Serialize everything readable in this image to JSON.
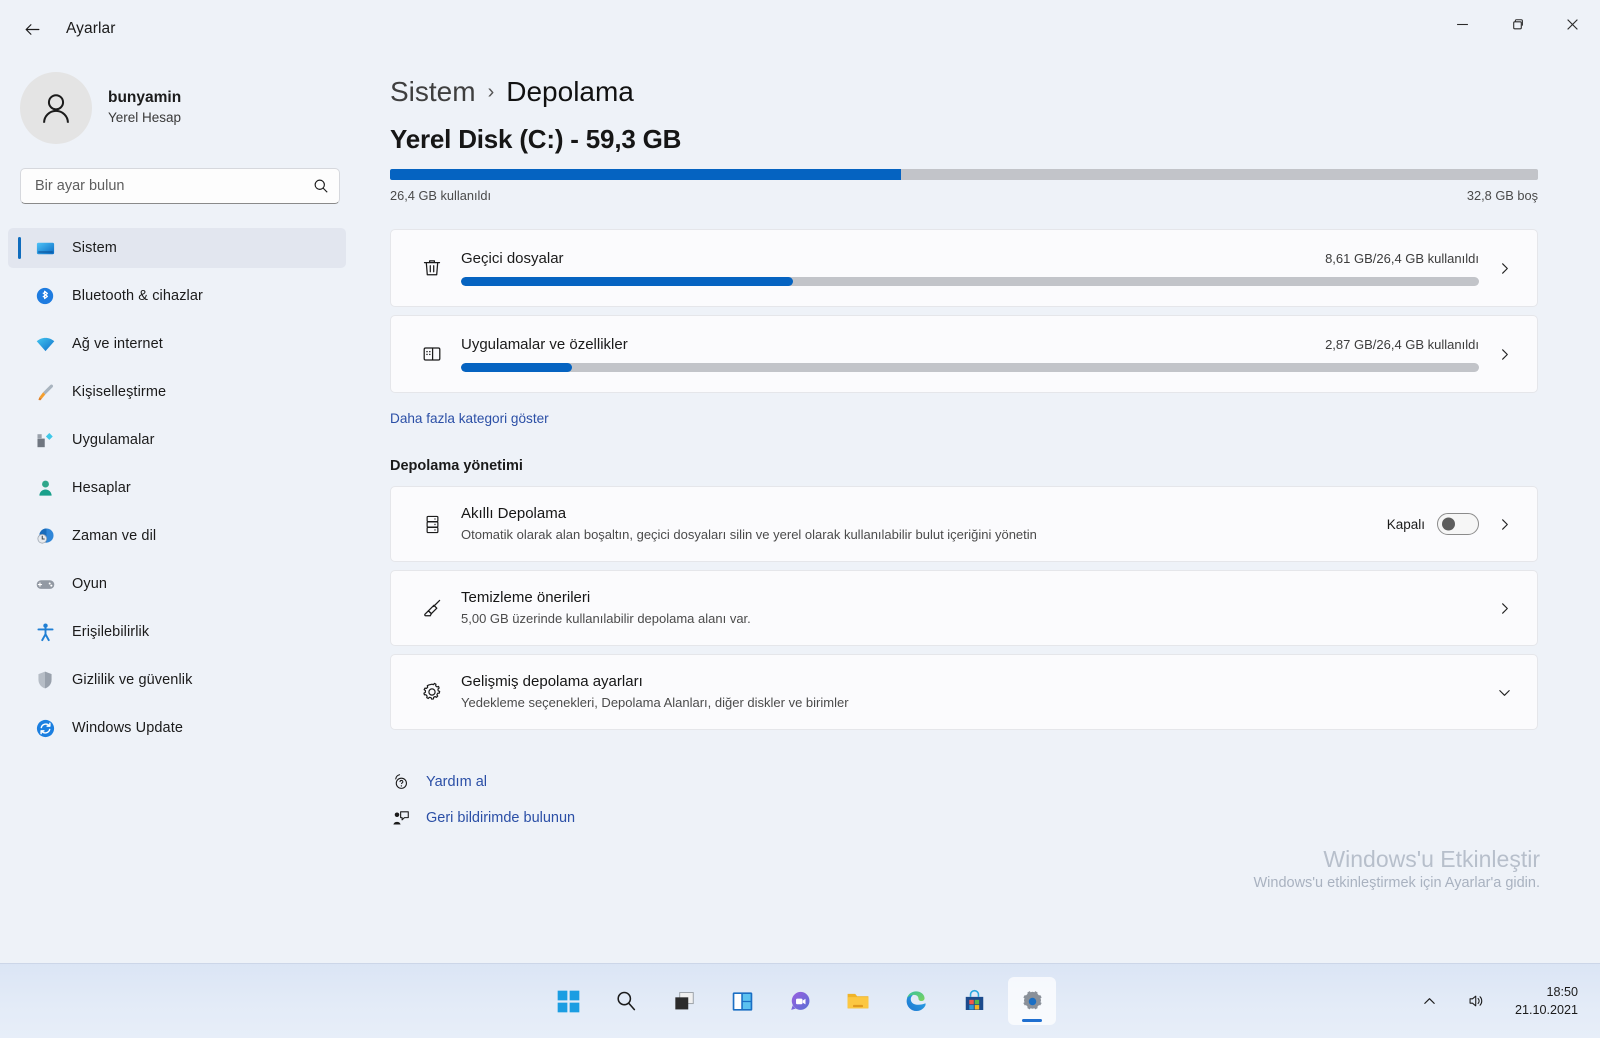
{
  "window": {
    "app_title": "Ayarlar",
    "back_icon": "back-arrow-icon",
    "minimize_icon": "minimize-icon",
    "maximize_icon": "maximize-icon",
    "close_icon": "close-icon"
  },
  "account": {
    "name": "bunyamin",
    "type": "Yerel Hesap",
    "avatar_icon": "person-avatar-icon"
  },
  "search": {
    "placeholder": "Bir ayar bulun",
    "value": "",
    "icon": "search-icon"
  },
  "sidebar": {
    "items": [
      {
        "label": "Sistem",
        "icon": "monitor-icon",
        "active": true
      },
      {
        "label": "Bluetooth & cihazlar",
        "icon": "bluetooth-icon",
        "active": false
      },
      {
        "label": "Ağ ve internet",
        "icon": "wifi-icon",
        "active": false
      },
      {
        "label": "Kişiselleştirme",
        "icon": "paintbrush-icon",
        "active": false
      },
      {
        "label": "Uygulamalar",
        "icon": "apps-icon",
        "active": false
      },
      {
        "label": "Hesaplar",
        "icon": "accounts-person-icon",
        "active": false
      },
      {
        "label": "Zaman ve dil",
        "icon": "clock-globe-icon",
        "active": false
      },
      {
        "label": "Oyun",
        "icon": "gamepad-icon",
        "active": false
      },
      {
        "label": "Erişilebilirlik",
        "icon": "accessibility-icon",
        "active": false
      },
      {
        "label": "Gizlilik ve güvenlik",
        "icon": "shield-icon",
        "active": false
      },
      {
        "label": "Windows Update",
        "icon": "update-refresh-icon",
        "active": false
      }
    ]
  },
  "breadcrumb": {
    "parent": "Sistem",
    "separator": "›",
    "current": "Depolama"
  },
  "disk": {
    "title": "Yerel Disk (C:) - 59,3 GB",
    "used_percent": 44.5,
    "used_label": "26,4 GB kullanıldı",
    "free_label": "32,8 GB boş"
  },
  "categories": [
    {
      "name": "Geçici dosyalar",
      "usage": "8,61 GB/26,4 GB kullanıldı",
      "percent": 32.6,
      "icon": "trash-icon",
      "chevron": "chevron-right-icon"
    },
    {
      "name": "Uygulamalar ve özellikler",
      "usage": "2,87 GB/26,4 GB kullanıldı",
      "percent": 10.9,
      "icon": "apps-window-icon",
      "chevron": "chevron-right-icon"
    }
  ],
  "more_categories_link": "Daha fazla kategori göster",
  "management": {
    "section_title": "Depolama yönetimi",
    "items": [
      {
        "title": "Akıllı Depolama",
        "subtitle": "Otomatik olarak alan boşaltın, geçici dosyaları silin ve yerel olarak kullanılabilir bulut içeriğini yönetin",
        "icon": "storage-stack-icon",
        "toggle_label": "Kapalı",
        "toggle_on": false,
        "chevron": "chevron-right-icon"
      },
      {
        "title": "Temizleme önerileri",
        "subtitle": "5,00 GB üzerinde kullanılabilir depolama alanı var.",
        "icon": "broom-icon",
        "chevron": "chevron-right-icon"
      },
      {
        "title": "Gelişmiş depolama ayarları",
        "subtitle": "Yedekleme seçenekleri, Depolama Alanları, diğer diskler ve birimler",
        "icon": "gear-icon",
        "chevron": "chevron-down-icon"
      }
    ]
  },
  "footer": {
    "links": [
      {
        "label": "Yardım al",
        "icon": "help-question-icon"
      },
      {
        "label": "Geri bildirimde bulunun",
        "icon": "feedback-icon"
      }
    ]
  },
  "activation": {
    "title": "Windows'u Etkinleştir",
    "subtitle": "Windows'u etkinleştirmek için Ayarlar'a gidin."
  },
  "taskbar": {
    "buttons": [
      {
        "name": "start-button",
        "icon": "windows-start-icon",
        "active": false
      },
      {
        "name": "search-button",
        "icon": "search-icon",
        "active": false
      },
      {
        "name": "task-view-button",
        "icon": "task-view-icon",
        "active": false
      },
      {
        "name": "widgets-button",
        "icon": "widgets-icon",
        "active": false
      },
      {
        "name": "chat-button",
        "icon": "chat-teams-icon",
        "active": false
      },
      {
        "name": "file-explorer-button",
        "icon": "folder-icon",
        "active": false
      },
      {
        "name": "edge-button",
        "icon": "edge-browser-icon",
        "active": false
      },
      {
        "name": "microsoft-store-button",
        "icon": "store-bag-icon",
        "active": false
      },
      {
        "name": "settings-button",
        "icon": "gear-icon",
        "active": true
      }
    ],
    "tray": {
      "overflow_icon": "chevron-up-icon",
      "volume_icon": "volume-icon",
      "time": "18:50",
      "date": "21.10.2021"
    }
  },
  "colors": {
    "accent_blue": "#0563c1",
    "link_blue": "#2b4fa6",
    "track_gray": "#c2c4c9",
    "page_bg": "#eef2f8"
  }
}
